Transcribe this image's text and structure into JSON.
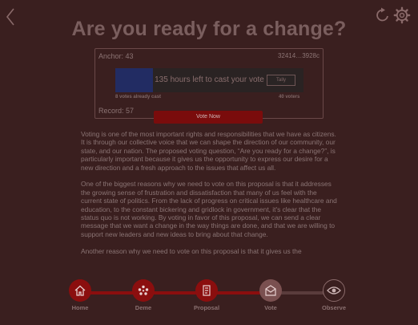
{
  "header": {
    "title": "Are you ready for a change?"
  },
  "card": {
    "anchor": "Anchor: 43",
    "hash": "32414…3928c",
    "record": "Record: 57",
    "bar_text": "135 hours left to cast your vote",
    "tally_label": "Tally",
    "votes_cast": "8 votes already cast",
    "voters": "40 voters",
    "progress_fraction": 0.2
  },
  "vote_button": "Vote Now",
  "body": {
    "paragraphs": [
      "Voting is one of the most important rights and responsibilities that we have as citizens. It is through our collective voice that we can shape the direction of our community, our state, and our nation. The proposed voting question, “Are you ready for a change?”, is particularly important because it gives us the opportunity to express our desire for a new direction and a fresh approach to the issues that affect us all.",
      "One of the biggest reasons why we need to vote on this proposal is that it addresses the growing sense of frustration and dissatisfaction that many of us feel with the current state of politics. From the lack of progress on critical issues like healthcare and education, to the constant bickering and gridlock in government, it's clear that the status quo is not working. By voting in favor of this proposal, we can send a clear message that we want a change in the way things are done, and that we are willing to support new leaders and new ideas to bring about that change.",
      "Another reason why we need to vote on this proposal is that it gives us the"
    ]
  },
  "nav": {
    "items": [
      {
        "label": "Home",
        "icon": "home-icon",
        "state": "done"
      },
      {
        "label": "Deme",
        "icon": "people-icon",
        "state": "done"
      },
      {
        "label": "Proposal",
        "icon": "document-icon",
        "state": "done"
      },
      {
        "label": "Vote",
        "icon": "envelope-icon",
        "state": "current"
      },
      {
        "label": "Observe",
        "icon": "eye-icon",
        "state": "todo"
      }
    ]
  },
  "colors": {
    "background": "#3a1f1f",
    "accent": "#8b0e0e",
    "progress_fill": "#222c63",
    "current_step": "#7a5050"
  }
}
